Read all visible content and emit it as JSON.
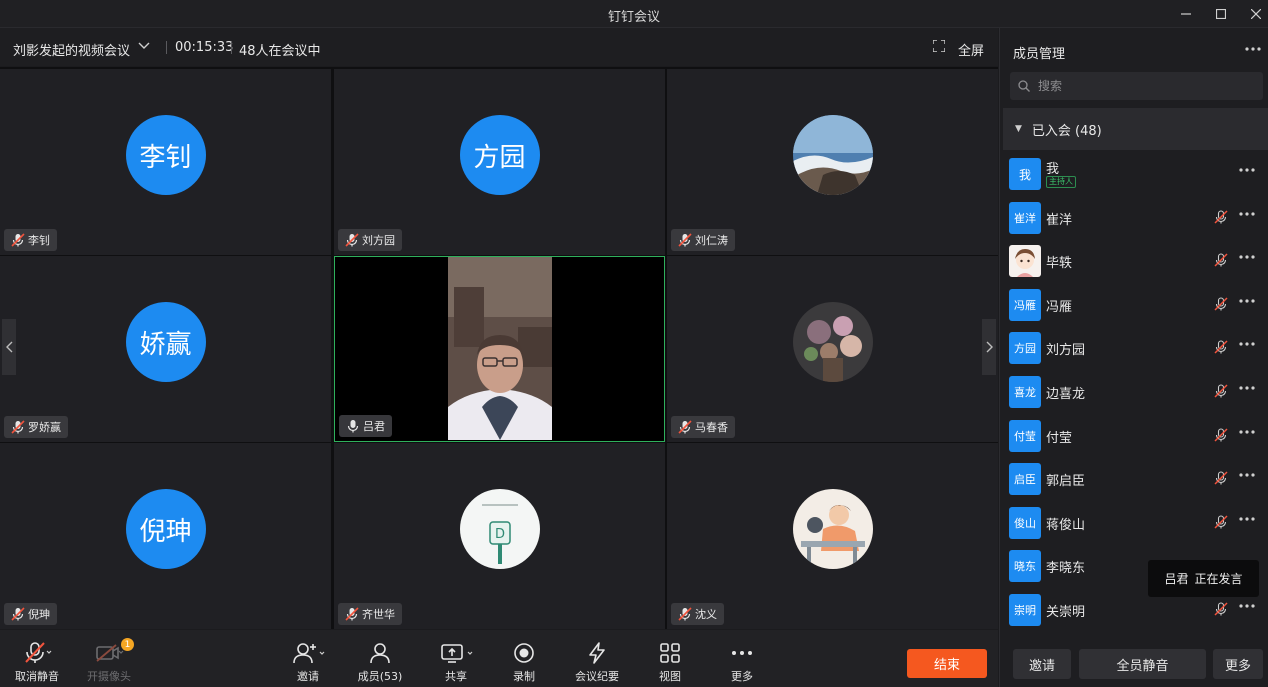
{
  "window": {
    "title": "钉钉会议"
  },
  "meeting": {
    "title": "刘影发起的视频会议",
    "timer": "00:15:33",
    "participants_text": "48人在会议中",
    "fullscreen_label": "全屏"
  },
  "tiles": [
    {
      "name": "李钊",
      "avatar_text": "李钊",
      "mic": "muted"
    },
    {
      "name": "刘方园",
      "avatar_text": "方园",
      "mic": "muted"
    },
    {
      "name": "刘仁涛",
      "avatar_text": "",
      "mic": "muted"
    },
    {
      "name": "罗娇赢",
      "avatar_text": "娇赢",
      "mic": "muted"
    },
    {
      "name": "吕君",
      "avatar_text": "",
      "mic": "on"
    },
    {
      "name": "马春香",
      "avatar_text": "",
      "mic": "muted"
    },
    {
      "name": "倪珅",
      "avatar_text": "倪珅",
      "mic": "muted"
    },
    {
      "name": "齐世华",
      "avatar_text": "",
      "mic": "muted"
    },
    {
      "name": "沈义",
      "avatar_text": "",
      "mic": "muted"
    }
  ],
  "toolbar": {
    "unmute": "取消静音",
    "camera": "开摄像头",
    "camera_badge": "1",
    "invite": "邀请",
    "members": "成员(53)",
    "share": "共享",
    "record": "录制",
    "minutes": "会议纪要",
    "view": "视图",
    "more": "更多",
    "end": "结束"
  },
  "panel": {
    "title": "成员管理",
    "search_placeholder": "搜索",
    "group_label": "已入会 (48)",
    "host_badge": "主持人",
    "members": [
      {
        "name": "我",
        "avatar": "我",
        "host": true
      },
      {
        "name": "崔洋",
        "avatar": "崔洋"
      },
      {
        "name": "毕轶",
        "avatar": ""
      },
      {
        "name": "冯雁",
        "avatar": "冯雁"
      },
      {
        "name": "刘方园",
        "avatar": "方园"
      },
      {
        "name": "边喜龙",
        "avatar": "喜龙"
      },
      {
        "name": "付莹",
        "avatar": "付莹"
      },
      {
        "name": "郭启臣",
        "avatar": "启臣"
      },
      {
        "name": "蒋俊山",
        "avatar": "俊山"
      },
      {
        "name": "李晓东",
        "avatar": "晓东"
      },
      {
        "name": "关崇明",
        "avatar": "崇明"
      }
    ],
    "tooltip_name": "吕君",
    "tooltip_status": "正在发言",
    "invite_button": "邀请",
    "mute_all_button": "全员静音",
    "more_button": "更多"
  },
  "colors": {
    "accent": "#1d8bf1",
    "end": "#f5581f",
    "speaking": "#2fb05c",
    "muted_slash": "#f2543d"
  }
}
